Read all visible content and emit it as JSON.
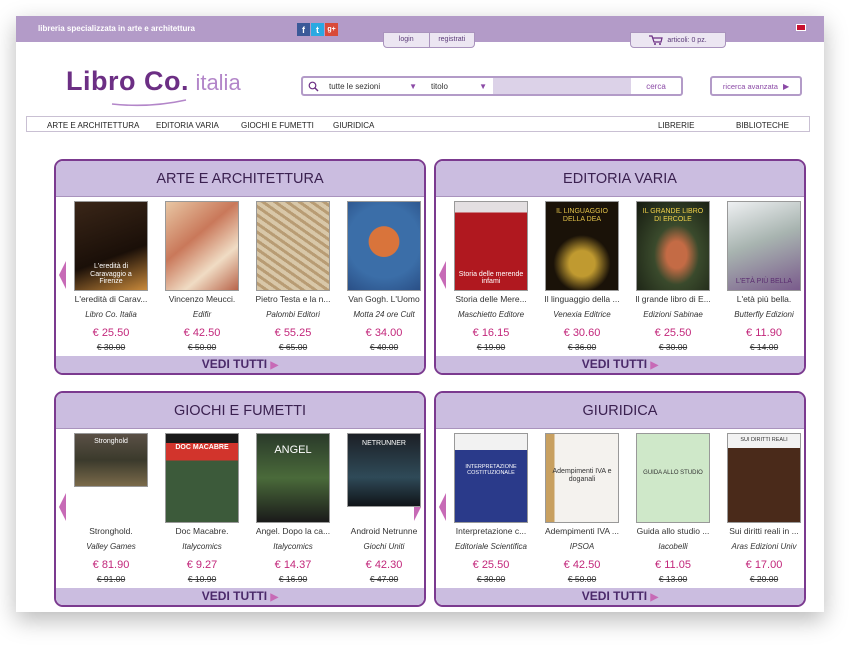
{
  "header": {
    "tagline": "libreria specializzata in arte e architettura",
    "login": "login",
    "register": "registrati",
    "cart": "articoli: 0 pz.",
    "logo_main": "Libro Co.",
    "logo_sub": "italia",
    "search_section": "tutte le sezioni",
    "search_field": "titolo",
    "search_button": "cerca",
    "advanced_search": "ricerca avanzata"
  },
  "nav": {
    "items": [
      "ARTE E ARCHITETTURA",
      "EDITORIA VARIA",
      "GIOCHI E FUMETTI",
      "GIURIDICA",
      "LIBRERIE",
      "BIBLIOTECHE"
    ]
  },
  "panels": [
    {
      "title": "ARTE E ARCHITETTURA",
      "footer": "VEDI TUTTI",
      "products": [
        {
          "title": "L'eredità di Carav...",
          "publisher": "Libro Co. Italia",
          "price": "€ 25.50",
          "old_price": "€ 30.00",
          "cover_text": "L'eredità di Caravaggio a Firenze"
        },
        {
          "title": "Vincenzo Meucci.",
          "publisher": "Edifir",
          "price": "€ 42.50",
          "old_price": "€ 50.00",
          "cover_text": ""
        },
        {
          "title": "Pietro Testa e la n...",
          "publisher": "Palombi Editori",
          "price": "€ 55.25",
          "old_price": "€ 65.00",
          "cover_text": ""
        },
        {
          "title": "Van Gogh. L'Uomo",
          "publisher": "Motta 24 ore Cult",
          "price": "€ 34.00",
          "old_price": "€ 40.00",
          "cover_text": ""
        }
      ]
    },
    {
      "title": "EDITORIA VARIA",
      "footer": "VEDI TUTTI",
      "products": [
        {
          "title": "Storia delle Mere...",
          "publisher": "Maschietto Editore",
          "price": "€ 16.15",
          "old_price": "€ 19.00",
          "cover_text": "Storia delle merende infami"
        },
        {
          "title": "Il linguaggio della ...",
          "publisher": "Venexia Editrice",
          "price": "€ 30.60",
          "old_price": "€ 36.00",
          "cover_text": "IL LINGUAGGIO DELLA DEA"
        },
        {
          "title": "Il grande libro di E...",
          "publisher": "Edizioni Sabinae",
          "price": "€ 25.50",
          "old_price": "€ 30.00",
          "cover_text": "IL GRANDE LIBRO DI ERCOLE"
        },
        {
          "title": "L'età più bella.",
          "publisher": "Butterfly Edizioni",
          "price": "€ 11.90",
          "old_price": "€ 14.00",
          "cover_text": "L'ETÀ PIÙ BELLA"
        }
      ]
    },
    {
      "title": "GIOCHI E FUMETTI",
      "footer": "VEDI TUTTI",
      "products": [
        {
          "title": "Stronghold.",
          "publisher": "Valley Games",
          "price": "€ 81.90",
          "old_price": "€ 91.00",
          "cover_text": "Stronghold"
        },
        {
          "title": "Doc Macabre.",
          "publisher": "Italycomics",
          "price": "€ 9.27",
          "old_price": "€ 10.90",
          "cover_text": "DOC MACABRE"
        },
        {
          "title": "Angel. Dopo la ca...",
          "publisher": "Italycomics",
          "price": "€ 14.37",
          "old_price": "€ 16.90",
          "cover_text": "ANGEL"
        },
        {
          "title": "Android Netrunne",
          "publisher": "Giochi Uniti",
          "price": "€ 42.30",
          "old_price": "€ 47.00",
          "cover_text": "NETRUNNER"
        }
      ]
    },
    {
      "title": "GIURIDICA",
      "footer": "VEDI TUTTI",
      "products": [
        {
          "title": "Interpretazione c...",
          "publisher": "Editoriale Scientifica",
          "price": "€ 25.50",
          "old_price": "€ 30.00",
          "cover_text": "INTERPRETAZIONE COSTITUZIONALE"
        },
        {
          "title": "Adempimenti IVA ...",
          "publisher": "IPSOA",
          "price": "€ 42.50",
          "old_price": "€ 50.00",
          "cover_text": "Adempimenti IVA e doganali"
        },
        {
          "title": "Guida allo studio ...",
          "publisher": "Iacobelli",
          "price": "€ 11.05",
          "old_price": "€ 13.00",
          "cover_text": "GUIDA ALLO STUDIO"
        },
        {
          "title": "Sui diritti reali in ...",
          "publisher": "Aras Edizioni Univ",
          "price": "€ 17.00",
          "old_price": "€ 20.00",
          "cover_text": "SUI DIRITTI REALI"
        }
      ]
    }
  ]
}
